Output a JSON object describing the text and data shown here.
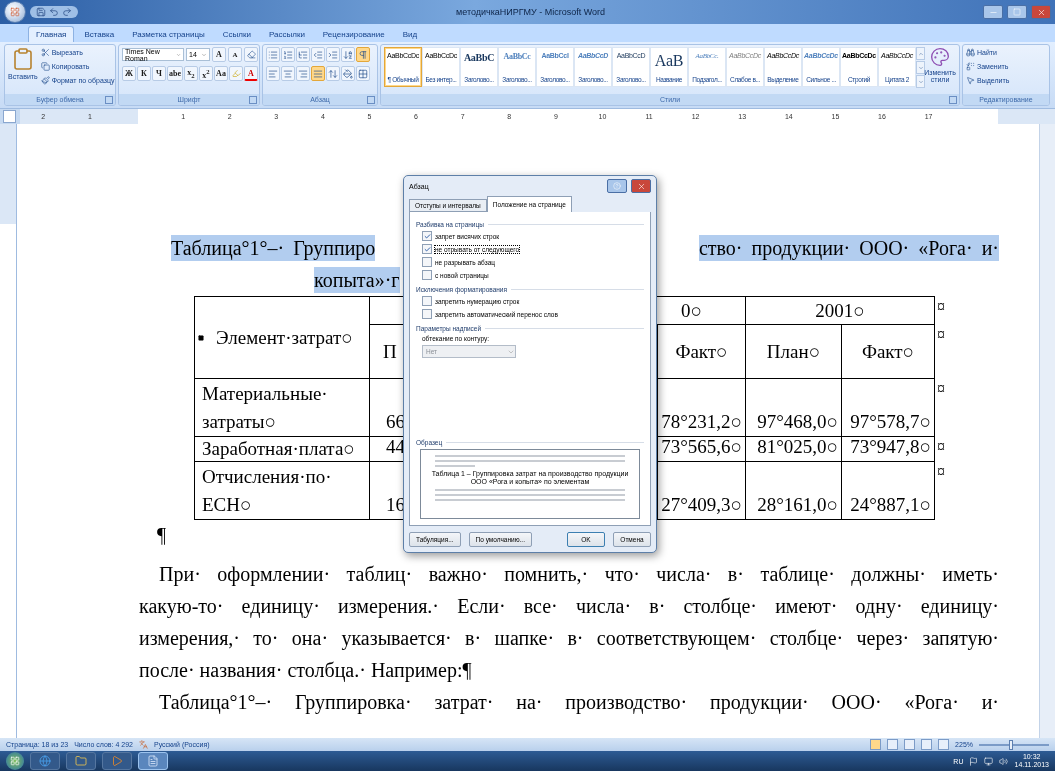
{
  "window": {
    "title": "методичкаНИРГМУ - Microsoft Word"
  },
  "ribbon_tabs": [
    {
      "label": "Главная",
      "selected": true
    },
    {
      "label": "Вставка",
      "selected": false
    },
    {
      "label": "Разметка страницы",
      "selected": false
    },
    {
      "label": "Ссылки",
      "selected": false
    },
    {
      "label": "Рассылки",
      "selected": false
    },
    {
      "label": "Рецензирование",
      "selected": false
    },
    {
      "label": "Вид",
      "selected": false
    }
  ],
  "clipboard": {
    "paste": "Вставить",
    "group_label": "Буфер обмена",
    "actions": [
      {
        "kind": "cut",
        "label": "Вырезать"
      },
      {
        "kind": "copy",
        "label": "Копировать"
      },
      {
        "kind": "format",
        "label": "Формат по образцу"
      }
    ]
  },
  "font": {
    "group_label": "Шрифт",
    "name": "Times New Roman",
    "size": "14",
    "grow": "A",
    "shrink": "A",
    "format_buttons": [
      "Ж",
      "К",
      "Ч",
      "abe",
      "x$_{2}$",
      "x$^{2}$",
      "Aa"
    ],
    "color_letter": "A"
  },
  "paragraph": {
    "group_label": "Абзац",
    "buttons": [
      {
        "kind": "bullets",
        "on": false
      },
      {
        "kind": "numbering",
        "on": false
      },
      {
        "kind": "multilevel",
        "on": false
      },
      {
        "kind": "outdent",
        "on": false
      },
      {
        "kind": "indent",
        "on": false
      },
      {
        "kind": "sort",
        "on": false
      },
      {
        "kind": "marks",
        "on": true
      }
    ],
    "align": [
      {
        "kind": "left",
        "selected": false
      },
      {
        "kind": "center",
        "selected": false
      },
      {
        "kind": "right",
        "selected": false
      },
      {
        "kind": "justify",
        "selected": true
      }
    ]
  },
  "styles": {
    "group_label": "Стили",
    "change_label": "Изменить стили",
    "items": [
      {
        "kind": "normal",
        "preview": "AaBbCcDc",
        "label": "¶ Обычный",
        "selected": true
      },
      {
        "kind": "normal",
        "preview": "AaBbCcDc",
        "label": "Без интер...",
        "selected": false
      },
      {
        "kind": "heading",
        "preview": "AaBbC",
        "label": "Заголово...",
        "selected": false
      },
      {
        "kind": "heading2",
        "preview": "AaBbCc",
        "label": "Заголово...",
        "selected": false
      },
      {
        "kind": "heading3",
        "preview": "AaBbCcI",
        "label": "Заголово...",
        "selected": false
      },
      {
        "kind": "heading4",
        "preview": "AaBbCcD",
        "label": "Заголово...",
        "selected": false
      },
      {
        "kind": "heading5",
        "preview": "AaBbCcD",
        "label": "Заголово...",
        "selected": false
      },
      {
        "kind": "title",
        "preview": "AaB",
        "label": "Название",
        "selected": false
      },
      {
        "kind": "subtitle",
        "preview": "AaBbCc.",
        "label": "Подзагол...",
        "selected": false
      },
      {
        "kind": "subtle",
        "preview": "AaBbCcDc",
        "label": "Слабое в...",
        "selected": false
      },
      {
        "kind": "emphasis",
        "preview": "AaBbCcDc",
        "label": "Выделение",
        "selected": false
      },
      {
        "kind": "intense",
        "preview": "AaBbCcDc",
        "label": "Сильное ...",
        "selected": false
      },
      {
        "kind": "strong",
        "preview": "AaBbCcDc",
        "label": "Строгий",
        "selected": false
      },
      {
        "kind": "quote",
        "preview": "AaBbCcDc",
        "label": "Цитата 2",
        "selected": false
      }
    ]
  },
  "editing": {
    "group_label": "Редактирование",
    "items": [
      {
        "kind": "find",
        "label": "Найти"
      },
      {
        "kind": "replace",
        "label": "Заменить"
      },
      {
        "kind": "select",
        "label": "Выделить"
      }
    ]
  },
  "ruler": {
    "left_labels": [
      "2",
      "1"
    ],
    "labels": [
      "1",
      "2",
      "3",
      "4",
      "5",
      "6",
      "7",
      "8",
      "9",
      "10",
      "11",
      "12",
      "13",
      "14",
      "15",
      "16",
      "17"
    ]
  },
  "document": {
    "caption": {
      "highlighted": true,
      "line1_left": "Таблица°1°–· Группиро",
      "line1_right": "ство· продукции· ООО· «Рога· и·",
      "line2": "копыта»·г"
    },
    "table": {
      "element_header": "Элемент·затрат○",
      "year_headers": [
        "0○",
        "2001○"
      ],
      "sub_headers": [
        "П",
        "Факт○",
        "План○",
        "Факт○"
      ],
      "header_end_marks": [
        "¤",
        "¤"
      ],
      "rows": [
        {
          "cells": [
            "Материальные· затраты○",
            "66",
            "78°231,2○",
            "97°468,0○",
            "97°578,7○"
          ],
          "end_mark": "¤"
        },
        {
          "cells": [
            "Заработная·плата○",
            "44",
            "73°565,6○",
            "81°025,0○",
            "73°947,8○"
          ],
          "end_mark": "¤"
        },
        {
          "cells": [
            "Отчисления·по· ЕСН○",
            "16",
            "27°409,3○",
            "28°161,0○",
            "24°887,1○"
          ],
          "end_mark": "¤"
        }
      ]
    },
    "empty_mark": "¶",
    "body_lines": [
      "При· оформлении· таблиц· важно· помнить,· что· числа· в· таблице· должны· иметь·",
      "какую-то· единицу· измерения.· Если· все· числа· в· столбце· имеют· одну· единицу·",
      "измерения,· то· она· указывается· в· шапке· в· соответствующем· столбце· через· запятую·",
      "после· названия· столбца.· Например:¶",
      "Таблица°1°–· Группировка· затрат· на· производство· продукции· ООО· «Рога· и·"
    ]
  },
  "dialog": {
    "title": "Абзац",
    "tabs": [
      {
        "label": "Отступы и интервалы",
        "selected": false
      },
      {
        "label": "Положение на странице",
        "selected": true
      }
    ],
    "sections": [
      {
        "title": "Разбивка на страницы",
        "options": [
          {
            "label": "запрет висячих строк",
            "checked": true,
            "focused": false
          },
          {
            "label": "не отрывать от следующего",
            "checked": true,
            "focused": true
          },
          {
            "label": "не разрывать абзац",
            "checked": false,
            "focused": false
          },
          {
            "label": "с новой страницы",
            "checked": false,
            "focused": false
          }
        ]
      },
      {
        "title": "Исключения форматирования",
        "options": [
          {
            "label": "запретить нумерацию строк",
            "checked": false,
            "focused": false
          },
          {
            "label": "запретить автоматический перенос слов",
            "checked": false,
            "focused": false
          }
        ]
      }
    ],
    "textbox": {
      "title": "Параметры надписей",
      "label": "обтекание по контуру:",
      "value": "Нет",
      "disabled": true
    },
    "sample": {
      "title": "Образец",
      "text": "Таблица 1 – Группировка затрат на производство продукции ООО «Рога и копыта» по элементам"
    },
    "buttons": [
      {
        "kind": "secondary",
        "label": "Табуляция..."
      },
      {
        "kind": "secondary",
        "label": "По умолчанию..."
      },
      {
        "kind": "default",
        "label": "OK"
      },
      {
        "kind": "secondary",
        "label": "Отмена"
      }
    ]
  },
  "status_bar": {
    "page": "Страница: 18 из 23",
    "words": "Число слов: 4 292",
    "language": "Русский (Россия)",
    "zoom": "225%",
    "zoom_slider": {
      "level": 0.45
    }
  },
  "taskbar": {
    "apps": [
      {
        "kind": "browser",
        "selected": false
      },
      {
        "kind": "folder",
        "selected": false
      },
      {
        "kind": "media",
        "selected": false
      },
      {
        "kind": "word",
        "selected": true
      }
    ],
    "language": "RU",
    "time": "10:32",
    "date": "14.11.2013"
  }
}
